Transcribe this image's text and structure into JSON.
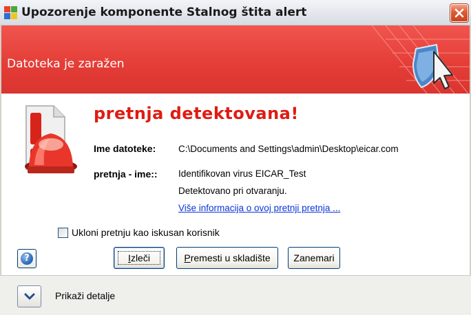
{
  "window": {
    "title": "Upozorenje komponente Stalnog štita alert"
  },
  "banner": {
    "text": "Datoteka je zaražen"
  },
  "threat": {
    "headline": "pretnja detektovana!",
    "file_name_label": "Ime datoteke:",
    "file_name_value": "C:\\Documents and Settings\\admin\\Desktop\\eicar.com",
    "threat_name_label": "pretnja - ime::",
    "threat_name_value": "Identifikovan virus EICAR_Test",
    "detection_text": "Detektovano pri otvaranju.",
    "more_info_link": "Više informacija o ovoj pretnji pretnja ..."
  },
  "options": {
    "expert_removal_label": "Ukloni pretnju kao iskusan korisnik",
    "expert_removal_checked": false
  },
  "buttons": {
    "help_icon": "question-mark-icon",
    "heal": "Izleči",
    "heal_accesskey": "I",
    "move_to_vault": "Premesti u skladište",
    "move_to_vault_accesskey": "P",
    "ignore": "Zanemari"
  },
  "footer": {
    "show_details": "Prikaži detalje",
    "expand_icon": "chevron-down-icon"
  },
  "colors": {
    "banner_red": "#e43c36",
    "headline_red": "#e01b12",
    "link_blue": "#0b33d8",
    "close_orange": "#de5a33"
  }
}
